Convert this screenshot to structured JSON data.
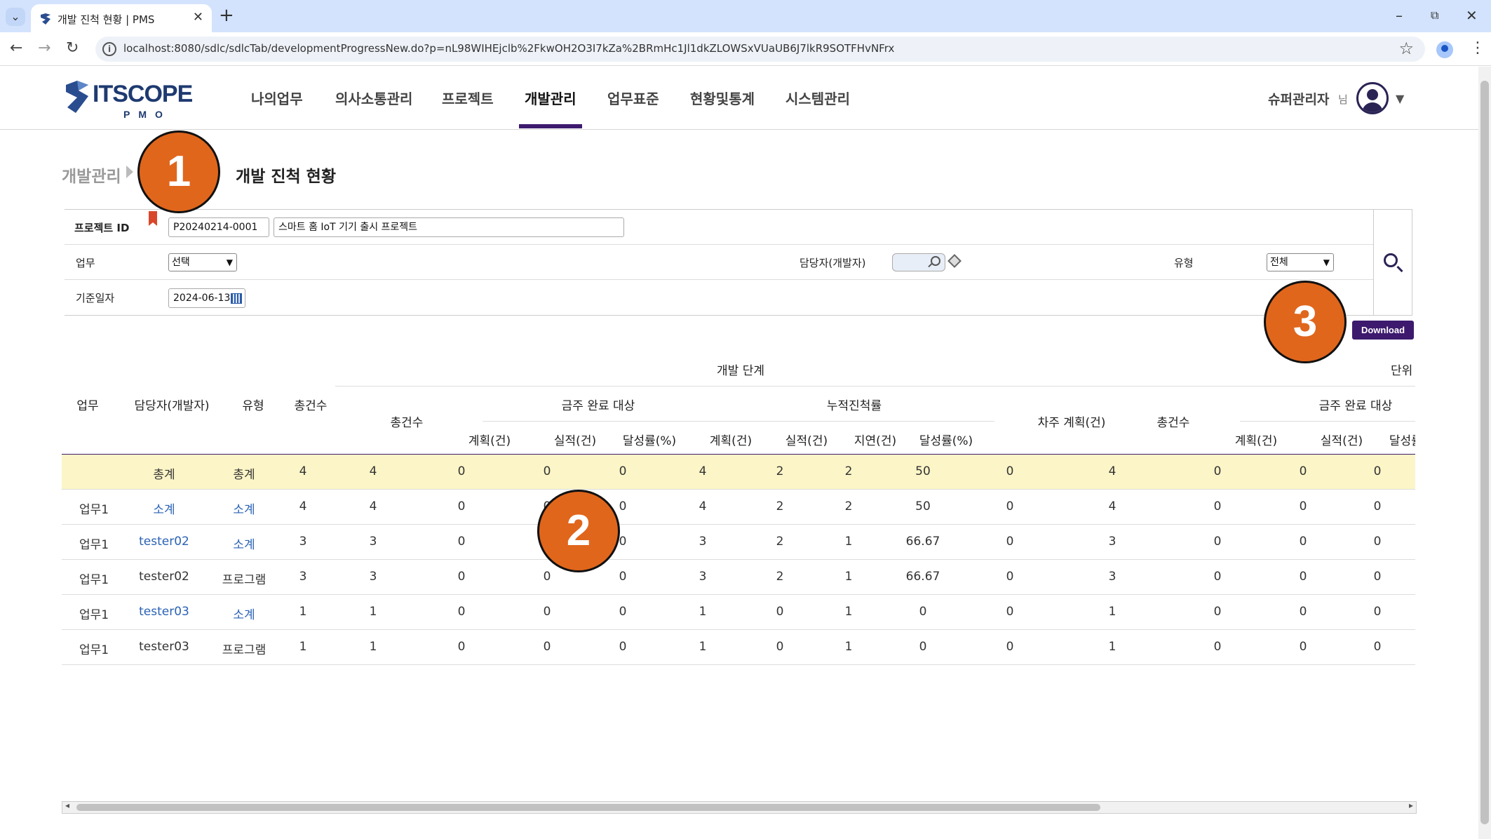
{
  "browser": {
    "tab_title": "개발 진척 현황 | PMS",
    "url": "localhost:8080/sdlc/sdlcTab/developmentProgressNew.do?p=nL98WIHEjclb%2FkwOH2O3I7kZa%2BRmHc1Jl1dkZLOWSxVUaUB6J7lkR9SOTFHvNFrx"
  },
  "header": {
    "logo_text": "ITSCOPE",
    "logo_sub": "PMO",
    "menu": [
      "나의업무",
      "의사소통관리",
      "프로젝트",
      "개발관리",
      "업무표준",
      "현황및통계",
      "시스템관리"
    ],
    "active_menu": "개발관리",
    "user_name": "슈퍼관리자",
    "user_suffix": "님"
  },
  "breadcrumb": {
    "parent": "개발관리",
    "current": "개발 진척 현황"
  },
  "markers": [
    "1",
    "2",
    "3"
  ],
  "form": {
    "project_id_label": "프로젝트 ID",
    "project_id": "P20240214-0001",
    "project_name": "스마트 홈 IoT 기기 출시 프로젝트",
    "task_label": "업무",
    "task_value": "선택",
    "developer_label": "담당자(개발자)",
    "type_label": "유형",
    "type_value": "전체",
    "date_label": "기준일자",
    "date_value": "2024-06-13"
  },
  "download_label": "Download",
  "grid": {
    "group_header": "개발 단계",
    "unit_label": "단위",
    "cols": {
      "task": "업무",
      "developer": "담당자(개발자)",
      "type": "유형",
      "total": "총건수",
      "stage_total": "총건수",
      "week_target": "금주 완료 대상",
      "cumulative": "누적진척률",
      "plan": "계획(건)",
      "actual": "실적(건)",
      "delay": "지연(건)",
      "rate": "달성률(%)",
      "next_week": "차주 계획(건)"
    },
    "rows": [
      [
        "",
        "총계",
        "총계",
        "4",
        "4",
        "0",
        "0",
        "0",
        "4",
        "2",
        "2",
        "50",
        "0",
        "4",
        "0",
        "0",
        "0"
      ],
      [
        "업무1",
        "소계",
        "소계",
        "4",
        "4",
        "0",
        "0",
        "0",
        "4",
        "2",
        "2",
        "50",
        "0",
        "4",
        "0",
        "0",
        "0"
      ],
      [
        "업무1",
        "tester02",
        "소계",
        "3",
        "3",
        "0",
        "0",
        "0",
        "3",
        "2",
        "1",
        "66.67",
        "0",
        "3",
        "0",
        "0",
        "0"
      ],
      [
        "업무1",
        "tester02",
        "프로그램",
        "3",
        "3",
        "0",
        "0",
        "0",
        "3",
        "2",
        "1",
        "66.67",
        "0",
        "3",
        "0",
        "0",
        "0"
      ],
      [
        "업무1",
        "tester03",
        "소계",
        "1",
        "1",
        "0",
        "0",
        "0",
        "1",
        "0",
        "1",
        "0",
        "0",
        "1",
        "0",
        "0",
        "0"
      ],
      [
        "업무1",
        "tester03",
        "프로그램",
        "1",
        "1",
        "0",
        "0",
        "0",
        "1",
        "0",
        "1",
        "0",
        "0",
        "1",
        "0",
        "0",
        "0"
      ]
    ]
  },
  "colors": {
    "accent": "#3d1a6e",
    "marker": "#e0661c",
    "total_row": "#fcf5c7",
    "link": "#2a62b5"
  }
}
